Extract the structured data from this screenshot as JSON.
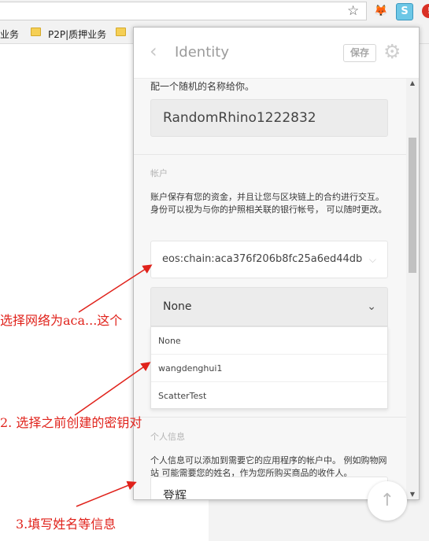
{
  "browser": {
    "bookmarks": [
      "业务",
      "P2P|质押业务"
    ]
  },
  "popup": {
    "title": "Identity",
    "save_label": "保存",
    "name_caption": "配一个随机的名称给你。",
    "identity_name": "RandomRhino1222832",
    "accounts_heading": "帐户",
    "accounts_desc": "账户保存有您的资金，并且让您与区块链上的合约进行交互。 身份可以视为与你的护照相关联的银行帐号， 可以随时更改。",
    "account_value": "eos:chain:aca376f206b8fc25a6ed44db",
    "key_select_value": "None",
    "key_options": [
      "None",
      "wangdenghui1",
      "ScatterTest"
    ],
    "personal_heading": "个人信息",
    "personal_desc": "个人信息可以添加到需要它的应用程序的帐户中。 例如购物网站 可能需要您的姓名，作为您所购买商品的收件人。",
    "personal_name_value": "登辉"
  },
  "annotations": [
    "选择网络为aca...这个",
    "2. 选择之前创建的密钥对",
    "3.填写姓名等信息"
  ],
  "colors": {
    "annotation": "#e0221b",
    "scatter_ext": "#6cc7e6"
  },
  "icons": [
    "star-icon",
    "metamask-fox-icon",
    "scatter-extension-icon",
    "back-chevron-icon",
    "gear-icon",
    "chevron-down-icon",
    "arrow-up-icon"
  ]
}
